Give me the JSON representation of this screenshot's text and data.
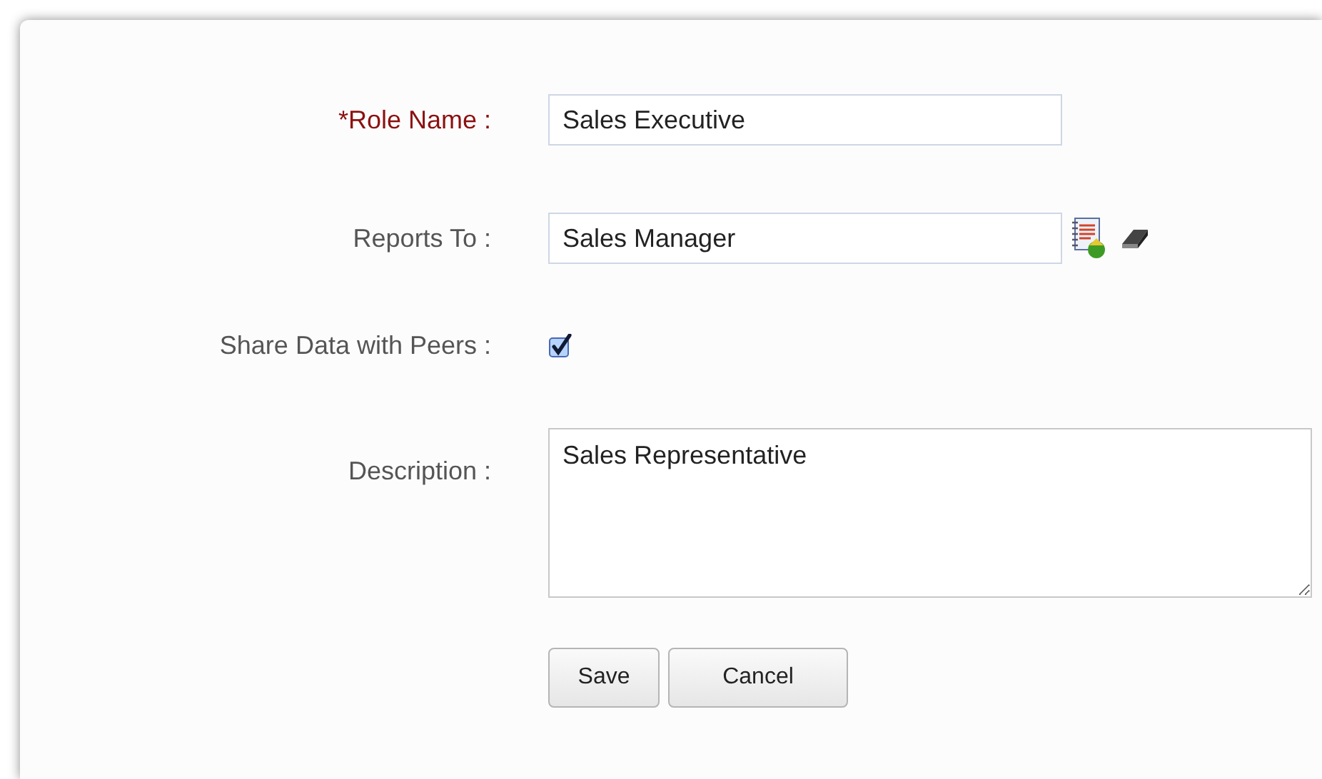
{
  "fields": [
    {
      "kind": "text",
      "label": "*Role Name :",
      "required": true,
      "value": "Sales Executive"
    },
    {
      "kind": "lookup",
      "label": "Reports To :",
      "required": false,
      "value": "Sales Manager"
    },
    {
      "kind": "checkbox",
      "label": "Share Data with Peers :",
      "required": false,
      "checked": true
    },
    {
      "kind": "textarea",
      "label": "Description :",
      "required": false,
      "value": "Sales Representative"
    }
  ],
  "buttons": [
    "Save",
    "Cancel"
  ]
}
